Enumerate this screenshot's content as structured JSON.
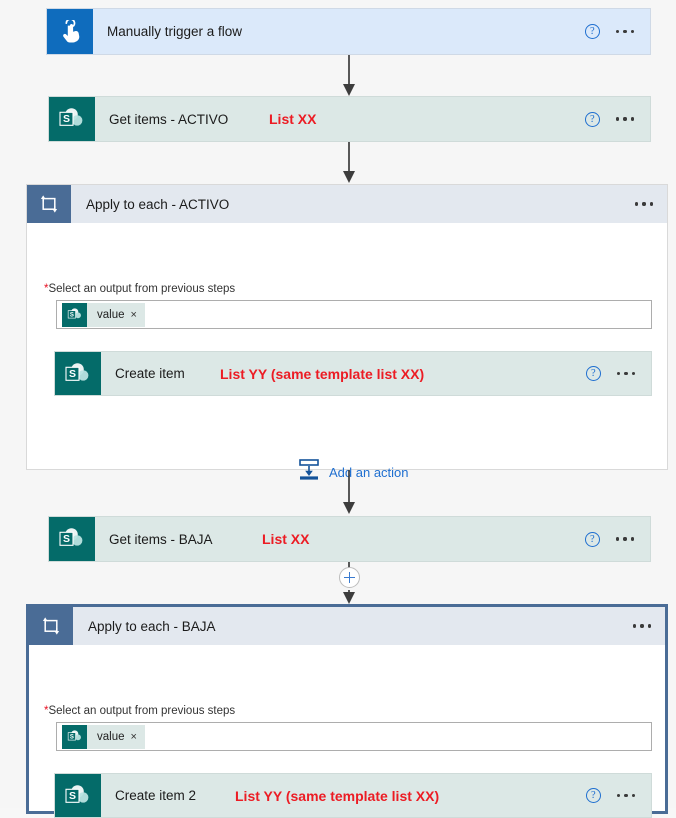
{
  "flow": {
    "nodes": [
      {
        "id": "trigger",
        "type": "trigger",
        "icon": "tap-hand-icon",
        "title": "Manually trigger a flow",
        "annotation": "",
        "help_label": "?",
        "menu_label": "More commands"
      },
      {
        "id": "get-items-activo",
        "type": "sharepoint",
        "icon": "sharepoint-icon",
        "title": "Get items - ACTIVO",
        "annotation": "List XX",
        "help_label": "?",
        "menu_label": "More commands"
      },
      {
        "id": "apply-to-each-activo",
        "type": "scope",
        "icon": "loop-icon",
        "title": "Apply to each - ACTIVO",
        "menu_label": "More commands",
        "field_label": "Select an output from previous steps",
        "required_marker": "*",
        "token": {
          "label": "value",
          "remove_label": "×",
          "icon": "sharepoint-icon"
        },
        "child": {
          "id": "create-item",
          "type": "sharepoint",
          "icon": "sharepoint-icon",
          "title": "Create item",
          "annotation": "List YY (same template list XX)",
          "help_label": "?",
          "menu_label": "More commands"
        },
        "add_action_label": "Add an action",
        "add_action_icon": "add-action-icon"
      },
      {
        "id": "get-items-baja",
        "type": "sharepoint",
        "icon": "sharepoint-icon",
        "title": "Get items - BAJA",
        "annotation": "List XX",
        "help_label": "?",
        "menu_label": "More commands"
      },
      {
        "id": "apply-to-each-baja",
        "type": "scope",
        "selected": true,
        "icon": "loop-icon",
        "title": "Apply to each - BAJA",
        "menu_label": "More commands",
        "field_label": "Select an output from previous steps",
        "required_marker": "*",
        "token": {
          "label": "value",
          "remove_label": "×",
          "icon": "sharepoint-icon"
        },
        "child": {
          "id": "create-item-2",
          "type": "sharepoint",
          "icon": "sharepoint-icon",
          "title": "Create item 2",
          "annotation": "List YY (same template list XX)",
          "help_label": "?",
          "menu_label": "More commands"
        }
      }
    ],
    "insert_button_label": "+"
  },
  "colors": {
    "trigger_card": "#dbe9fa",
    "trigger_icon": "#0f6cbd",
    "sharepoint_card": "#dce8e6",
    "sharepoint_icon": "#046b69",
    "scope_header": "#e3e8ef",
    "scope_icon": "#4a6c96",
    "annotation_red": "#ec1c24",
    "link_blue": "#1f6fd0",
    "canvas": "#f6f6f6"
  }
}
